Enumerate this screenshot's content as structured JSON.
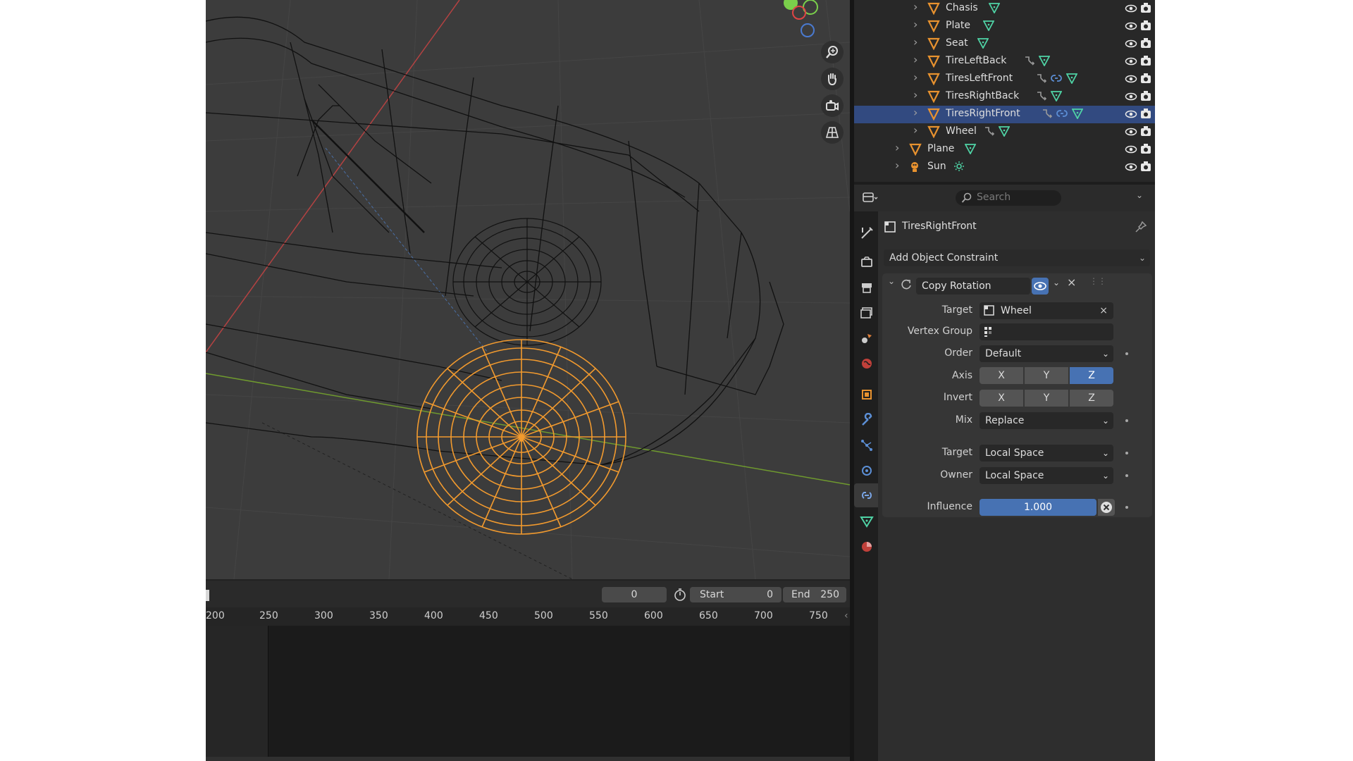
{
  "outliner": {
    "rows": [
      {
        "name": "Chasis",
        "level": 2,
        "selected": false
      },
      {
        "name": "Plate",
        "level": 2,
        "selected": false
      },
      {
        "name": "Seat",
        "level": 2,
        "selected": false
      },
      {
        "name": "TireLeftBack",
        "level": 2,
        "selected": false
      },
      {
        "name": "TiresLeftFront",
        "level": 2,
        "selected": false
      },
      {
        "name": "TiresRightBack",
        "level": 2,
        "selected": false
      },
      {
        "name": "TiresRightFront",
        "level": 2,
        "selected": true
      },
      {
        "name": "Wheel",
        "level": 2,
        "selected": false
      },
      {
        "name": "Plane",
        "level": 1,
        "selected": false
      },
      {
        "name": "Sun",
        "level": 1,
        "selected": false
      }
    ]
  },
  "properties": {
    "search_placeholder": "Search",
    "object_name": "TiresRightFront",
    "add_constraint_label": "Add Object Constraint",
    "constraint": {
      "name": "Copy Rotation",
      "target_label": "Target",
      "target_value": "Wheel",
      "vertex_group_label": "Vertex Group",
      "vertex_group_value": "",
      "order_label": "Order",
      "order_value": "Default",
      "axis_label": "Axis",
      "axis_options": [
        "X",
        "Y",
        "Z"
      ],
      "axis_active": [
        false,
        false,
        true
      ],
      "invert_label": "Invert",
      "invert_options": [
        "X",
        "Y",
        "Z"
      ],
      "mix_label": "Mix",
      "mix_value": "Replace",
      "target_space_label": "Target",
      "target_space_value": "Local Space",
      "owner_space_label": "Owner",
      "owner_space_value": "Local Space",
      "influence_label": "Influence",
      "influence_value": "1.000"
    }
  },
  "timeline": {
    "current_frame": "0",
    "start_label": "Start",
    "start_value": "0",
    "end_label": "End",
    "end_value": "250",
    "ruler": [
      "200",
      "250",
      "300",
      "350",
      "400",
      "450",
      "500",
      "550",
      "600",
      "650",
      "700",
      "750"
    ]
  },
  "colors": {
    "selection_orange": "#f29a2e",
    "accent_blue": "#4772b3",
    "mesh_green": "#4fd3a5",
    "object_orange": "#e8922f"
  }
}
